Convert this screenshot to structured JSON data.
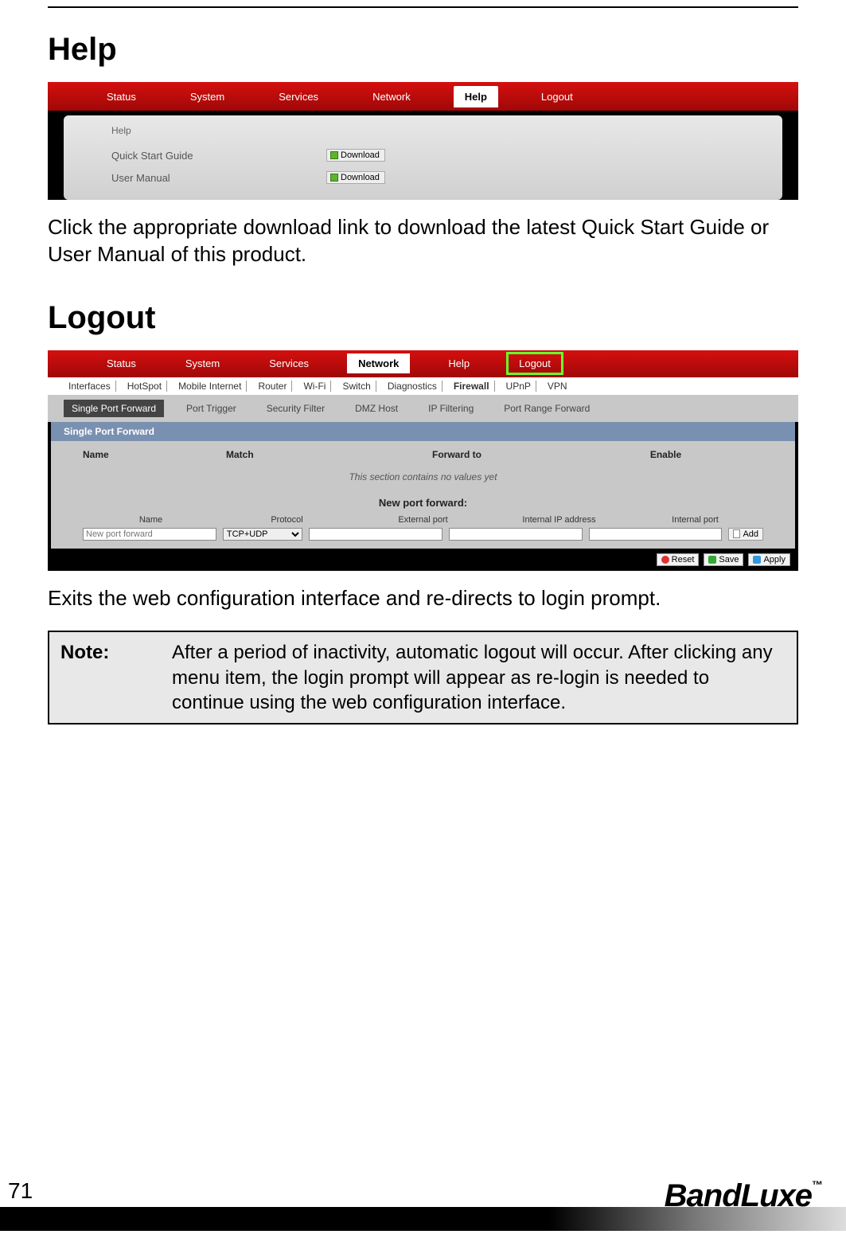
{
  "section1": {
    "title": "Help",
    "body": "Click the appropriate download link to download the latest Quick Start Guide or User Manual of this product."
  },
  "shot1": {
    "nav": [
      "Status",
      "System",
      "Services",
      "Network",
      "Help",
      "Logout"
    ],
    "nav_active": "Help",
    "header": "Help",
    "rows": [
      {
        "label": "Quick Start Guide",
        "btn": "Download"
      },
      {
        "label": "User Manual",
        "btn": "Download"
      }
    ]
  },
  "section2": {
    "title": "Logout",
    "body": "Exits the web configuration interface and re-directs to login prompt."
  },
  "shot2": {
    "nav": [
      "Status",
      "System",
      "Services",
      "Network",
      "Help",
      "Logout"
    ],
    "nav_active": "Network",
    "nav_highlight": "Logout",
    "subnav": [
      "Interfaces",
      "HotSpot",
      "Mobile Internet",
      "Router",
      "Wi-Fi",
      "Switch",
      "Diagnostics",
      "Firewall",
      "UPnP",
      "VPN"
    ],
    "subnav_bold": "Firewall",
    "tabs": [
      "Single Port Forward",
      "Port Trigger",
      "Security Filter",
      "DMZ Host",
      "IP Filtering",
      "Port Range Forward"
    ],
    "tab_active": "Single Port Forward",
    "panel_title": "Single Port Forward",
    "thead": [
      "Name",
      "Match",
      "Forward to",
      "Enable"
    ],
    "empty": "This section contains no values yet",
    "npf_title": "New port forward:",
    "npf_labels": [
      "Name",
      "Protocol",
      "External port",
      "Internal IP address",
      "Internal port"
    ],
    "name_placeholder": "New port forward",
    "protocol_value": "TCP+UDP",
    "add_btn": "Add",
    "footer_btns": [
      "Reset",
      "Save",
      "Apply"
    ]
  },
  "note": {
    "label": "Note:",
    "body": "After a period of inactivity, automatic logout will occur. After clicking any menu item, the login prompt will appear as re-login is needed to continue using the web configuration interface."
  },
  "footer": {
    "page": "71",
    "brand": "BandLuxe",
    "tm": "™"
  }
}
